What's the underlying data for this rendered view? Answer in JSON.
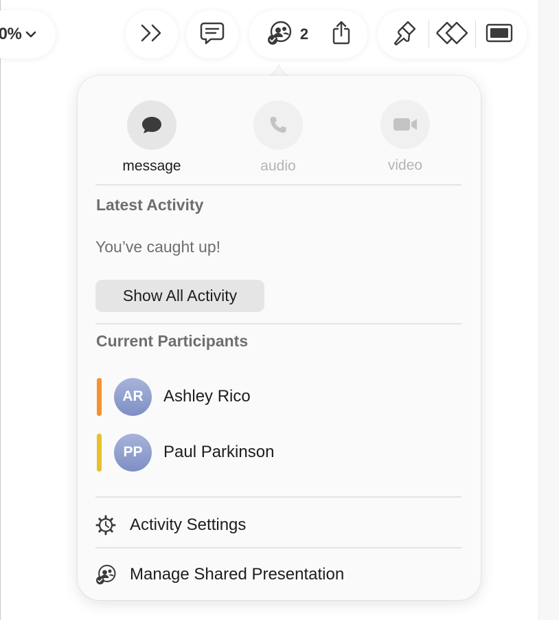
{
  "toolbar": {
    "zoom_value": "0%",
    "zoom_icon": "chevron-down-icon",
    "more_icon": "double-chevron-right-icon",
    "comment_icon": "comment-icon",
    "collaborate_icon": "collaborate-icon",
    "participant_count": "2",
    "share_icon": "share-icon",
    "format_icon": "paintbrush-icon",
    "animate_icon": "animate-diamond-icon",
    "document_icon": "document-panel-icon"
  },
  "popover": {
    "actions": [
      {
        "label": "message",
        "icon": "message-bubble-icon",
        "enabled": true
      },
      {
        "label": "audio",
        "icon": "phone-icon",
        "enabled": false
      },
      {
        "label": "video",
        "icon": "video-camera-icon",
        "enabled": false
      }
    ],
    "latest_activity_title": "Latest Activity",
    "caught_up_text": "You’ve caught up!",
    "show_all_label": "Show All Activity",
    "current_participants_title": "Current Participants",
    "participants": [
      {
        "initials": "AR",
        "name": "Ashley Rico",
        "color": "#f5922f"
      },
      {
        "initials": "PP",
        "name": "Paul Parkinson",
        "color": "#e6c12a"
      }
    ],
    "activity_settings_label": "Activity Settings",
    "activity_settings_icon": "activity-gear-icon",
    "manage_label": "Manage Shared Presentation",
    "manage_icon": "collaborate-icon"
  },
  "colors": {
    "popover_bg": "#fafafa",
    "button_bg": "#e5e5e5",
    "secondary_text": "#6e6e6e",
    "avatar_blue": "#8f9ecf"
  }
}
